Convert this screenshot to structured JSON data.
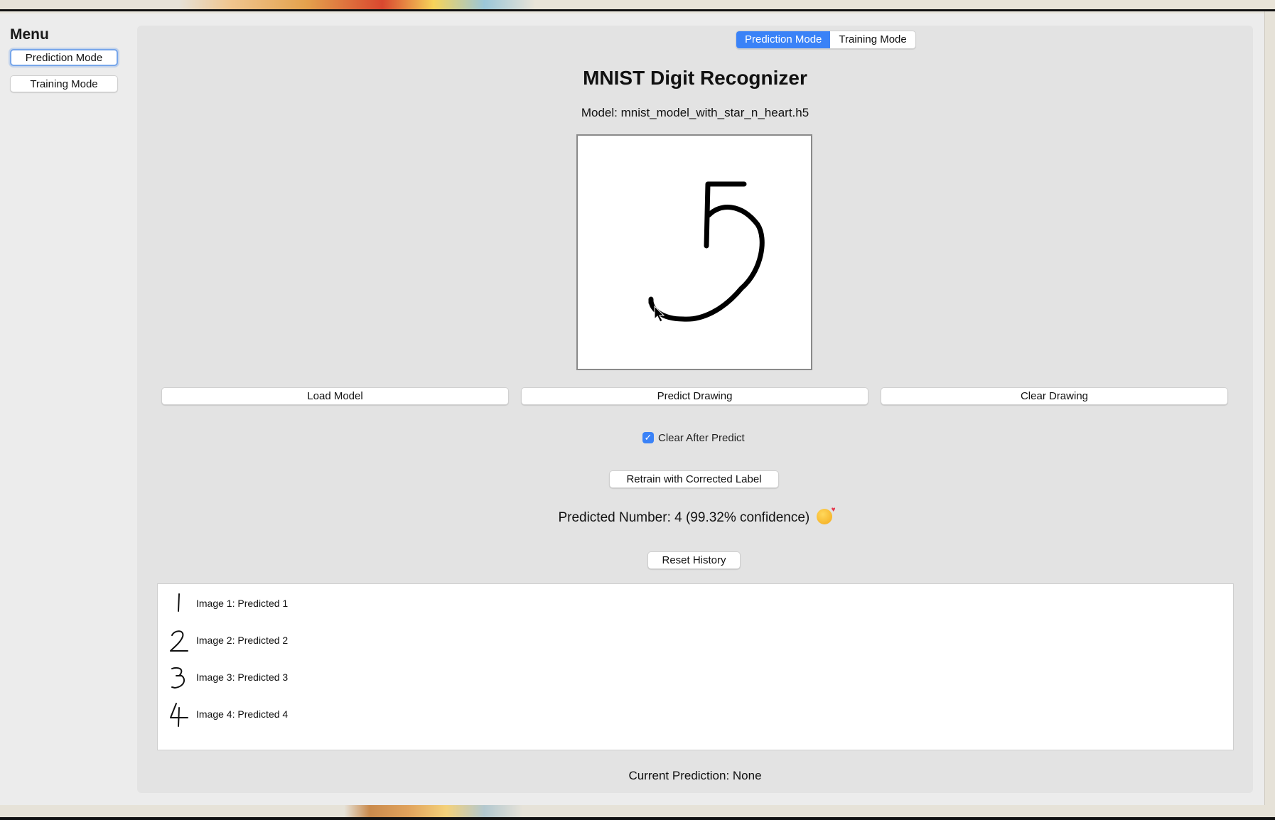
{
  "sidebar": {
    "title": "Menu",
    "buttons": [
      {
        "label": "Prediction Mode",
        "focused": true
      },
      {
        "label": "Training Mode",
        "focused": false
      }
    ]
  },
  "tabs": [
    {
      "label": "Prediction Mode",
      "active": true
    },
    {
      "label": "Training Mode",
      "active": false
    }
  ],
  "main": {
    "title": "MNIST Digit Recognizer",
    "model_label": "Model: mnist_model_with_star_n_heart.h5",
    "buttons": {
      "load": "Load Model",
      "predict": "Predict Drawing",
      "clear": "Clear Drawing",
      "retrain": "Retrain with Corrected Label",
      "reset": "Reset History"
    },
    "checkbox": {
      "label": "Clear After Predict",
      "checked": true
    },
    "prediction_text": "Predicted Number: 4 (99.32% confidence)",
    "prediction_emoji": "smiling-face-with-hearts-icon",
    "current_prediction": "Current Prediction: None"
  },
  "history": [
    {
      "digit": "1",
      "label": "Image 1: Predicted 1"
    },
    {
      "digit": "2",
      "label": "Image 2: Predicted 2"
    },
    {
      "digit": "3",
      "label": "Image 3: Predicted 3"
    },
    {
      "digit": "4",
      "label": "Image 4: Predicted 4"
    }
  ],
  "colors": {
    "accent": "#3a82f7",
    "focus_ring": "#77a6ea",
    "panel": "#e3e3e3",
    "window": "#ececec"
  }
}
